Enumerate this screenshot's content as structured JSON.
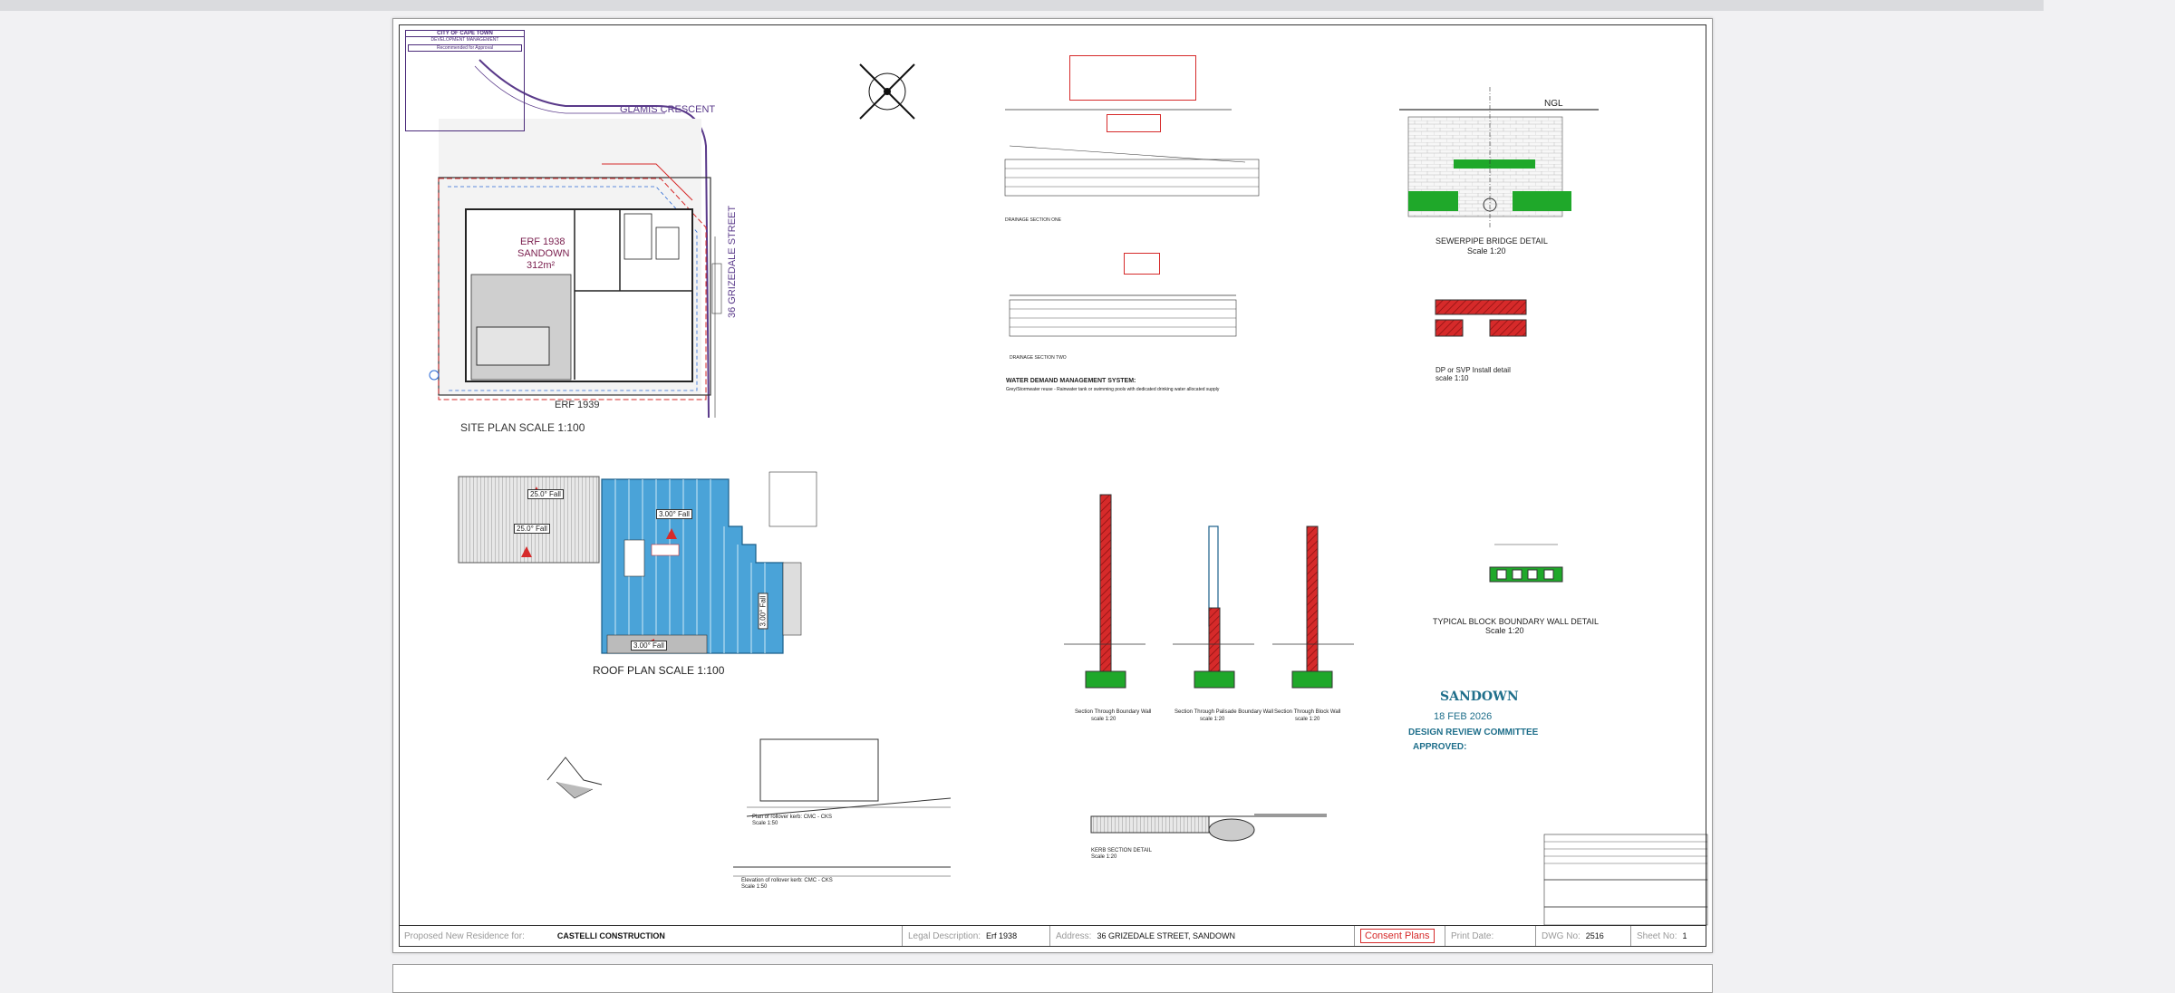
{
  "document": {
    "site_plan": {
      "street_north": "GLAMIS CRESCENT",
      "street_east": "36 GRIZEDALE STREET",
      "erf_label": "ERF 1938",
      "suburb": "SANDOWN",
      "area": "312m²",
      "erf_south": "ERF 1939",
      "caption": "SITE PLAN SCALE 1:100"
    },
    "roof_plan": {
      "caption": "ROOF PLAN SCALE 1:100",
      "falls": [
        "25.0° Fall",
        "25.0° Fall",
        "3.00° Fall",
        "3.00° Fall",
        "3.00° Fall"
      ]
    },
    "drainage": {
      "section_one": "DRAINAGE SECTION ONE",
      "section_two": "DRAINAGE SECTION TWO",
      "water_demand_title": "WATER DEMAND MANAGEMENT SYSTEM:",
      "water_demand_sub": "Grey/Stormwater reuse - Rainwater tank or swimming pools with dedicated drinking water allocated supply"
    },
    "sewer": {
      "ngl": "NGL",
      "title": "SEWERPIPE BRIDGE DETAIL",
      "scale": "Scale 1:20",
      "install_title": "DP or SVP Install detail",
      "install_scale": "scale 1:10"
    },
    "walls": {
      "sec1": "Section Through Boundary Wall",
      "sec2": "Section Through Palisade Boundary Wall",
      "sec3": "Section Through Block Wall",
      "scale": "scale 1:20",
      "typical_title": "TYPICAL BLOCK BOUNDARY WALL DETAIL",
      "typical_scale": "Scale 1:20"
    },
    "kerb": {
      "section": "KERB SECTION DETAIL",
      "scale": "Scale 1:20"
    },
    "refuse": {
      "plan": "Plan of rollover kerb: CMC - CKS",
      "plan_scale": "Scale 1:50",
      "elev": "Elevation of rollover kerb: CMC - CKS",
      "elev_scale": "Scale 1:50"
    },
    "stamp": {
      "brand": "SANDOWN",
      "date": "18 FEB 2026",
      "committee": "DESIGN REVIEW COMMITTEE",
      "approved": "APPROVED:"
    },
    "council_box": {
      "title": "CITY OF CAPE TOWN",
      "sub": "DEVELOPMENT MANAGEMENT",
      "status": "Recommended for Approval"
    }
  },
  "title_block": {
    "project_caption": "Proposed New Residence for:",
    "client": "CASTELLI CONSTRUCTION",
    "legal_caption": "Legal Description:",
    "legal_value": "Erf 1938",
    "address_caption": "Address:",
    "address_value": "36 GRIZEDALE STREET, SANDOWN",
    "plan_status": "Consent Plans",
    "print_caption": "Print Date:",
    "dwg_caption": "DWG No:",
    "dwg_value": "2516",
    "sheet_caption": "Sheet No:",
    "sheet_value": "1"
  },
  "colors": {
    "red_hatch": "#d62a2a",
    "roof_blue": "#4aa3d8",
    "grass_green": "#1fa82a",
    "street_purple": "#5a3a8a",
    "stamp_teal": "#1f6f8b"
  }
}
